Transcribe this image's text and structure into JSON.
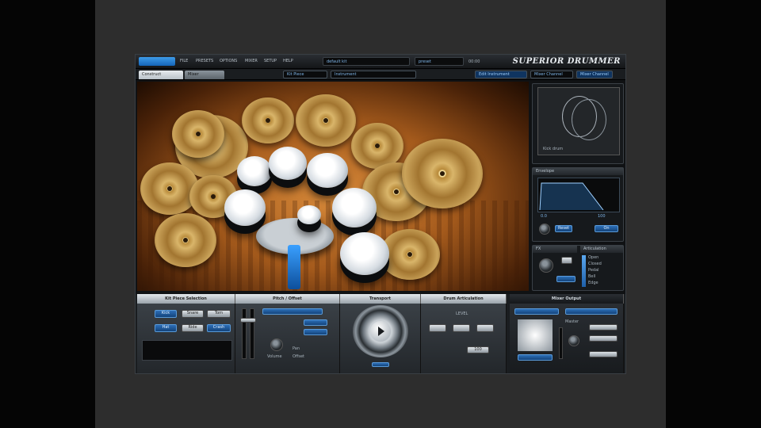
{
  "app": {
    "brand": "SUPERIOR DRUMMER",
    "menu_items": [
      "FILE",
      "PRESETS",
      "OPTIONS",
      "MIXER",
      "SETUP",
      "HELP"
    ],
    "top_dropdowns": [
      "default kit",
      "preset"
    ],
    "status_readout": "00:00"
  },
  "tabs": [
    {
      "label": "Construct"
    },
    {
      "label": "Mixer"
    }
  ],
  "tabbar_fields": [
    "Kit Piece",
    "Instrument",
    "Edit Instrument",
    "Mixer Channel"
  ],
  "instrument_panel": {
    "caption": "Kick drum"
  },
  "envelope_panel": {
    "title": "Envelope",
    "buttons": [
      "Reset",
      "On"
    ],
    "values": [
      "0.0",
      "100"
    ]
  },
  "fx_panel": {
    "title": "FX",
    "title2": "Articulation",
    "options": [
      "Open",
      "Closed",
      "Pedal",
      "Bell",
      "Edge"
    ]
  },
  "bottom": {
    "sections": [
      {
        "title": "Kit Piece Selection"
      },
      {
        "title": "Pitch / Offset"
      },
      {
        "title": "Transport"
      },
      {
        "title": "Drum Articulation"
      },
      {
        "title": "Mixer Output"
      }
    ],
    "kit_buttons": [
      "Kick",
      "Snare",
      "Tom",
      "Hat",
      "Ride",
      "Crash"
    ],
    "pitch_labels": [
      "Volume",
      "Pan",
      "Offset"
    ],
    "transport_play": "play",
    "artic_label": "LEVEL",
    "artic_value": "100",
    "mixer_label": "Master"
  },
  "colors": {
    "accent": "#2d7fd0",
    "brand_text": "#e8ecf0",
    "stage_warm": "#c87a30"
  }
}
